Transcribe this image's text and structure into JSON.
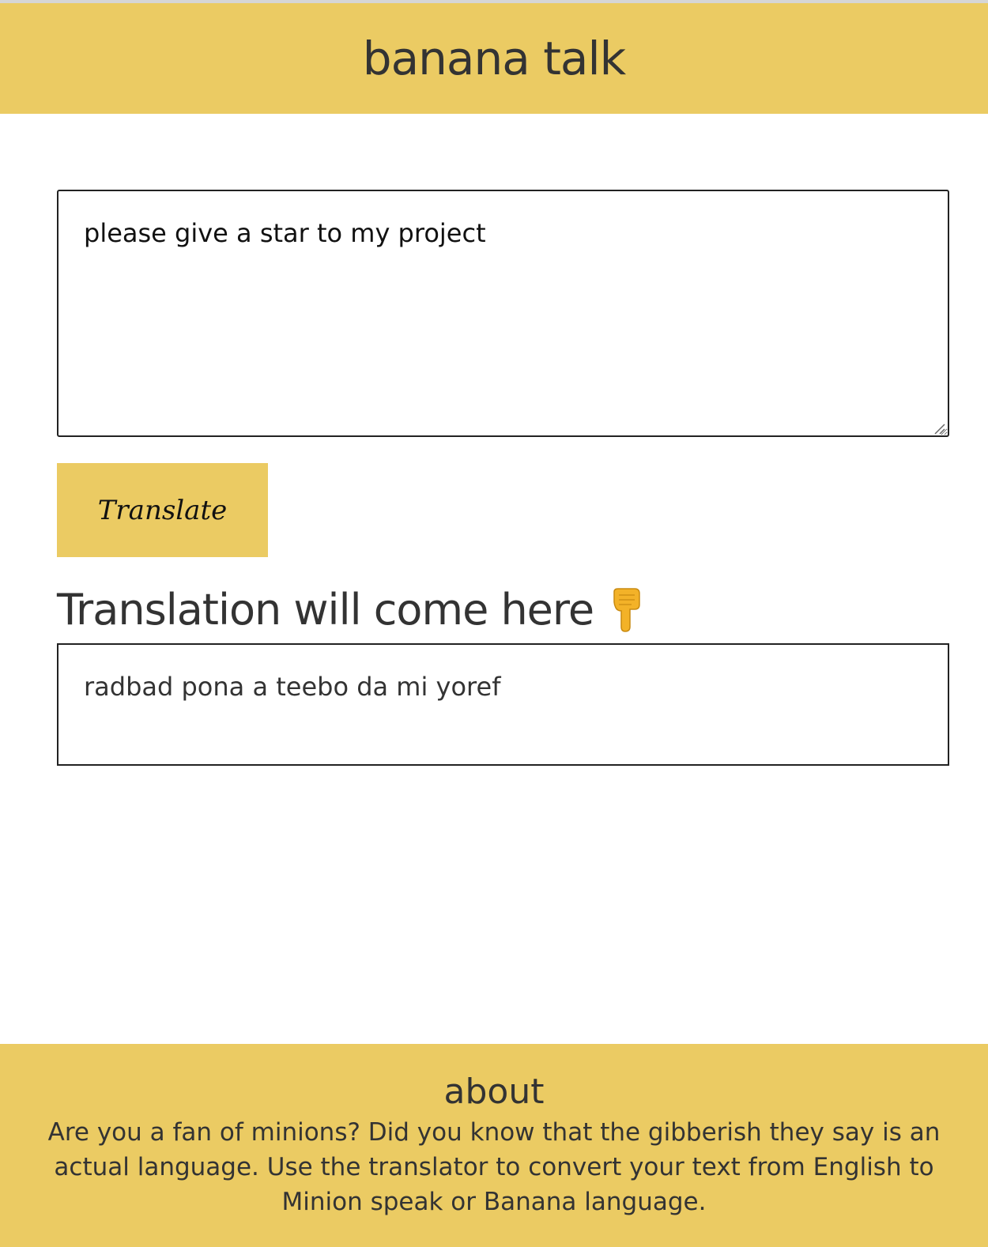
{
  "header": {
    "title": "banana talk"
  },
  "input": {
    "value": "please give a star to my project"
  },
  "translate_button": {
    "label": "Translate"
  },
  "output": {
    "heading": "Translation will come here",
    "heading_icon": "pointing-down-hand-icon",
    "text": "radbad pona a teebo da mi yoref"
  },
  "footer": {
    "title": "about",
    "description": "Are you a fan of minions? Did you know that the gibberish they say is an actual language. Use the translator to convert your text from English to Minion speak or Banana language."
  },
  "colors": {
    "accent": "#ebcb63",
    "text": "#333333",
    "border": "#222222"
  }
}
